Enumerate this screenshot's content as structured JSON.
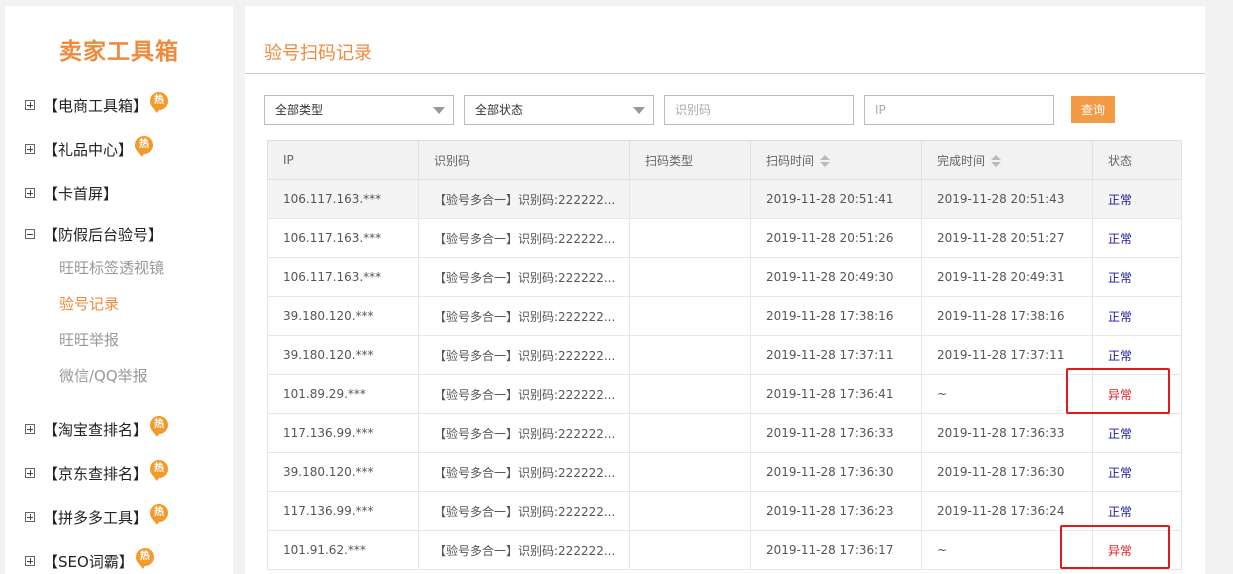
{
  "sidebar": {
    "brand": "卖家工具箱",
    "hot_badge": "热",
    "items": [
      {
        "label": "【电商工具箱】",
        "hot": true
      },
      {
        "label": "【礼品中心】",
        "hot": true
      },
      {
        "label": "【卡首屏】",
        "hot": false
      },
      {
        "label": "【防假后台验号】",
        "hot": false,
        "expanded": true
      },
      {
        "label": "【淘宝查排名】",
        "hot": true
      },
      {
        "label": "【京东查排名】",
        "hot": true
      },
      {
        "label": "【拼多多工具】",
        "hot": true
      },
      {
        "label": "【SEO词霸】",
        "hot": true
      }
    ],
    "sub_items": [
      {
        "label": "旺旺标签透视镜",
        "active": false
      },
      {
        "label": "验号记录",
        "active": true
      },
      {
        "label": "旺旺举报",
        "active": false
      },
      {
        "label": "微信/QQ举报",
        "active": false
      }
    ]
  },
  "main": {
    "title": "验号扫码记录",
    "filters": {
      "type_select": "全部类型",
      "status_select": "全部状态",
      "code_placeholder": "识别码",
      "ip_placeholder": "IP",
      "query_label": "查询"
    },
    "table": {
      "headers": [
        "IP",
        "识别码",
        "扫码类型",
        "扫码时间",
        "完成时间",
        "状态"
      ],
      "rows": [
        [
          "106.117.163.***",
          "【验号多合一】识别码:222222...",
          "",
          "2019-11-28 20:51:41",
          "2019-11-28 20:51:43",
          "正常"
        ],
        [
          "106.117.163.***",
          "【验号多合一】识别码:222222...",
          "",
          "2019-11-28 20:51:26",
          "2019-11-28 20:51:27",
          "正常"
        ],
        [
          "106.117.163.***",
          "【验号多合一】识别码:222222...",
          "",
          "2019-11-28 20:49:30",
          "2019-11-28 20:49:31",
          "正常"
        ],
        [
          "39.180.120.***",
          "【验号多合一】识别码:222222...",
          "",
          "2019-11-28 17:38:16",
          "2019-11-28 17:38:16",
          "正常"
        ],
        [
          "39.180.120.***",
          "【验号多合一】识别码:222222...",
          "",
          "2019-11-28 17:37:11",
          "2019-11-28 17:37:11",
          "正常"
        ],
        [
          "101.89.29.***",
          "【验号多合一】识别码:222222...",
          "",
          "2019-11-28 17:36:41",
          "~",
          "异常"
        ],
        [
          "117.136.99.***",
          "【验号多合一】识别码:222222...",
          "",
          "2019-11-28 17:36:33",
          "2019-11-28 17:36:33",
          "正常"
        ],
        [
          "39.180.120.***",
          "【验号多合一】识别码:222222...",
          "",
          "2019-11-28 17:36:30",
          "2019-11-28 17:36:30",
          "正常"
        ],
        [
          "117.136.99.***",
          "【验号多合一】识别码:222222...",
          "",
          "2019-11-28 17:36:23",
          "2019-11-28 17:36:24",
          "正常"
        ],
        [
          "101.91.62.***",
          "【验号多合一】识别码:222222...",
          "",
          "2019-11-28 17:36:17",
          "~",
          "异常"
        ]
      ]
    }
  },
  "colors": {
    "accent": "#f08a3c",
    "button": "#f39a45",
    "status_normal": "#1a1aa0",
    "status_abnormal": "#dd2222",
    "highlight": "#e01919"
  }
}
